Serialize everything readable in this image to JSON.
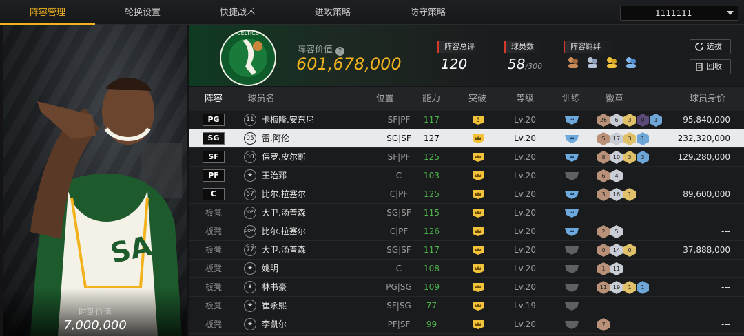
{
  "nav": {
    "tabs": [
      "阵容管理",
      "轮换设置",
      "快捷战术",
      "进攻策略",
      "防守策略"
    ],
    "active_index": 0,
    "account": "1111111"
  },
  "portrait": {
    "value_label": "时刻价值",
    "value": "7,000,000"
  },
  "summary": {
    "lineup_value_label": "阵容价值",
    "lineup_value": "601,678,000",
    "overall_label": "阵容总评",
    "overall_value": "120",
    "players_label": "球员数",
    "players_value": "58",
    "players_max": "/300",
    "bonds_label": "阵容羁绊",
    "scout_button": "选拔",
    "recycle_button": "回收"
  },
  "table": {
    "headers": [
      "阵容",
      "球员名",
      "位置",
      "能力",
      "突破",
      "等级",
      "训练",
      "徽章",
      "球员身价"
    ],
    "rows": [
      {
        "slot": "PG",
        "starter": true,
        "num": "11",
        "name": "卡梅隆.安东尼",
        "pos": "SF|PF",
        "ability": "117",
        "break": "5",
        "level": "Lv.20",
        "train": "blue",
        "badges": [
          "26",
          "6",
          "3",
          "0",
          "1"
        ],
        "salary": "95,840,000"
      },
      {
        "slot": "SG",
        "starter": true,
        "num": "05",
        "name": "雷.阿伦",
        "pos": "SG|SF",
        "ability": "127",
        "break": "crown",
        "level": "Lv.20",
        "train": "blue",
        "badges": [
          "5",
          "17",
          "3",
          "1"
        ],
        "salary": "232,320,000"
      },
      {
        "slot": "SF",
        "starter": true,
        "num": "00",
        "name": "保罗.皮尔斯",
        "pos": "SF|PF",
        "ability": "125",
        "break": "crown",
        "level": "Lv.20",
        "train": "blue",
        "badges": [
          "8",
          "10",
          "3",
          "3"
        ],
        "salary": "129,280,000"
      },
      {
        "slot": "PF",
        "starter": true,
        "num": "★",
        "name": "王治郅",
        "pos": "C",
        "ability": "103",
        "break": "crown",
        "level": "Lv.20",
        "train": "gray",
        "badges": [
          "6",
          "4"
        ],
        "salary": "---"
      },
      {
        "slot": "C",
        "starter": true,
        "num": "67",
        "name": "比尔.拉塞尔",
        "pos": "C|PF",
        "ability": "125",
        "break": "crown",
        "level": "Lv.20",
        "train": "blue",
        "badges": [
          "3",
          "16",
          "1"
        ],
        "salary": "89,600,000"
      },
      {
        "slot": "板凳",
        "starter": false,
        "num": "COPY",
        "name": "大卫.汤普森",
        "pos": "SG|SF",
        "ability": "115",
        "break": "crown",
        "level": "Lv.20",
        "train": "blue",
        "badges": [],
        "salary": "---"
      },
      {
        "slot": "板凳",
        "starter": false,
        "num": "COPY",
        "name": "比尔.拉塞尔",
        "pos": "C|PF",
        "ability": "126",
        "break": "crown",
        "level": "Lv.20",
        "train": "blue",
        "badges": [
          "2",
          "5"
        ],
        "salary": "---"
      },
      {
        "slot": "板凳",
        "starter": false,
        "num": "77",
        "name": "大卫.汤普森",
        "pos": "SG|SF",
        "ability": "117",
        "break": "crown",
        "level": "Lv.20",
        "train": "gray",
        "badges": [
          "0",
          "14",
          "0"
        ],
        "salary": "37,888,000"
      },
      {
        "slot": "板凳",
        "starter": false,
        "num": "★",
        "name": "姚明",
        "pos": "C",
        "ability": "108",
        "break": "crown",
        "level": "Lv.20",
        "train": "gray",
        "badges": [
          "1",
          "11"
        ],
        "salary": "---"
      },
      {
        "slot": "板凳",
        "starter": false,
        "num": "★",
        "name": "林书豪",
        "pos": "PG|SG",
        "ability": "109",
        "break": "crown",
        "level": "Lv.20",
        "train": "gray",
        "badges": [
          "11",
          "19",
          "1",
          "1"
        ],
        "salary": "---"
      },
      {
        "slot": "板凳",
        "starter": false,
        "num": "★",
        "name": "崔永熙",
        "pos": "SF|SG",
        "ability": "77",
        "break": "crown",
        "level": "Lv.19",
        "train": "gray",
        "badges": [],
        "salary": "---"
      },
      {
        "slot": "板凳",
        "starter": false,
        "num": "★",
        "name": "李凯尔",
        "pos": "PF|SF",
        "ability": "99",
        "break": "crown",
        "level": "Lv.20",
        "train": "gray",
        "badges": [
          "7"
        ],
        "salary": "---"
      }
    ]
  },
  "colors": {
    "accent": "#f1b21c",
    "ability_green": "#4cb34a",
    "stat_red": "#d33a2c",
    "selected_row": "#e9eaec"
  }
}
